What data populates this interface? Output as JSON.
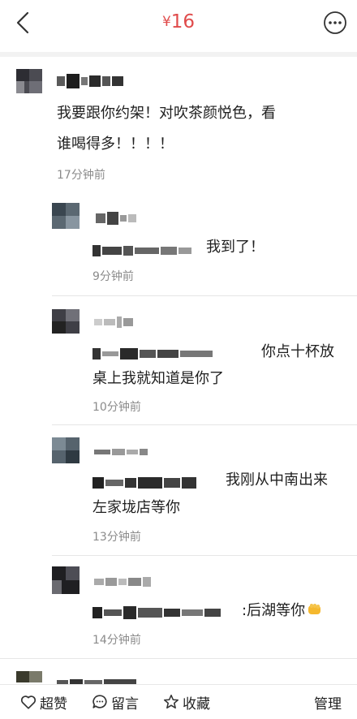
{
  "header": {
    "currency_symbol": "¥",
    "price": "16",
    "accent_color": "#e04b4b",
    "back_icon": "chevron-left-icon",
    "more_icon": "more-dots-icon"
  },
  "comment": {
    "text_line1": "我要跟你约架！对吹茶颜悦色，看",
    "text_line2": "谁喝得多！！！！",
    "time": "17分钟前"
  },
  "replies": [
    {
      "text_line1": "我到了！",
      "text_line2": "",
      "time": "9分钟前"
    },
    {
      "text_line1": "你点十杯放",
      "text_line2": "桌上我就知道是你了",
      "time": "10分钟前"
    },
    {
      "text_line1": "我刚从中南出来",
      "text_line2": "左家垅店等你",
      "time": "13分钟前"
    },
    {
      "text_line1": ":后湖等你",
      "text_line2": "",
      "time": "14分钟前",
      "emoji": "fist-emoji"
    }
  ],
  "bottom_bar": {
    "like_label": "超赞",
    "comment_label": "留言",
    "favorite_label": "收藏",
    "manage_label": "管理"
  }
}
